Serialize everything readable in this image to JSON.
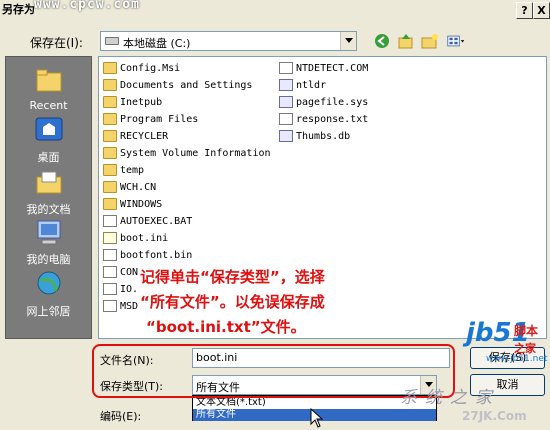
{
  "title_bar": {
    "title": "另存为",
    "watermark": "www.cpcw.com",
    "help_button": "?",
    "close_button": "X"
  },
  "save_in": {
    "label": "保存在(I):",
    "location": "本地磁盘 (C:)"
  },
  "toolbar": {
    "icons": [
      "back-icon",
      "up-folder-icon",
      "new-folder-icon",
      "views-menu-icon"
    ]
  },
  "places": [
    {
      "label": "Recent",
      "icon": "recent-documents-icon"
    },
    {
      "label": "桌面",
      "icon": "desktop-icon"
    },
    {
      "label": "我的文档",
      "icon": "my-documents-icon"
    },
    {
      "label": "我的电脑",
      "icon": "my-computer-icon"
    },
    {
      "label": "网上邻居",
      "icon": "network-places-icon"
    }
  ],
  "files_col1": [
    {
      "name": "Config.Msi",
      "type": "folder"
    },
    {
      "name": "Documents and Settings",
      "type": "folder"
    },
    {
      "name": "Inetpub",
      "type": "folder"
    },
    {
      "name": "Program Files",
      "type": "folder"
    },
    {
      "name": "RECYCLER",
      "type": "folder"
    },
    {
      "name": "System Volume Information",
      "type": "folder"
    },
    {
      "name": "temp",
      "type": "folder"
    },
    {
      "name": "WCH.CN",
      "type": "folder"
    },
    {
      "name": "WINDOWS",
      "type": "folder"
    },
    {
      "name": "AUTOEXEC.BAT",
      "type": "file"
    },
    {
      "name": "boot.ini",
      "type": "ini"
    },
    {
      "name": "bootfont.bin",
      "type": "file"
    },
    {
      "name": "CON",
      "type": "file"
    },
    {
      "name": "IO.",
      "type": "file"
    },
    {
      "name": "MSD",
      "type": "file"
    }
  ],
  "files_col2": [
    {
      "name": "NTDETECT.COM",
      "type": "file"
    },
    {
      "name": "ntldr",
      "type": "sys"
    },
    {
      "name": "pagefile.sys",
      "type": "sys"
    },
    {
      "name": "response.txt",
      "type": "file"
    },
    {
      "name": "Thumbs.db",
      "type": "sys"
    }
  ],
  "annotation": {
    "line1": "记得单击“保存类型”，选择",
    "line2": "“所有文件”。以免误保存成",
    "line3": "“boot.ini.txt”文件。"
  },
  "filename": {
    "label": "文件名(N):",
    "value": "boot.ini"
  },
  "save_as_type": {
    "label": "保存类型(T):",
    "value": "所有文件"
  },
  "encoding": {
    "label": "编码(E):"
  },
  "buttons": {
    "save": "保存(S)",
    "cancel": "取消"
  },
  "type_options": [
    "文本文档(*.txt)",
    "所有文件"
  ],
  "watermarks": {
    "jb51_a": "jb51",
    "jb51_b": "脚本",
    "jb51_c": "之家",
    "jb51_d": "www.jb51.net",
    "site2": "系统之家",
    "site2_url": "27JK.Com"
  }
}
